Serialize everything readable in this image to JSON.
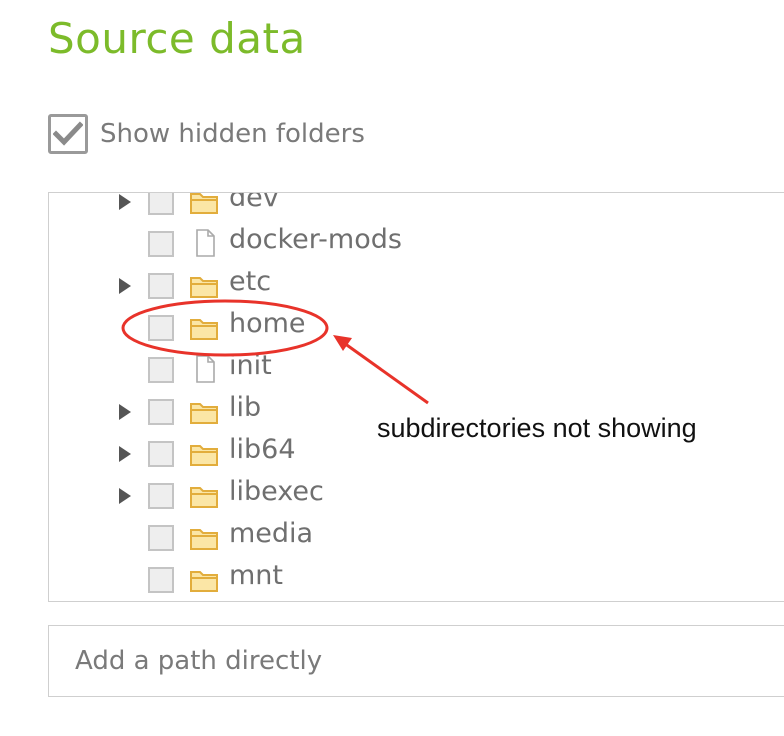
{
  "page": {
    "title": "Source data",
    "show_hidden": {
      "label": "Show hidden folders",
      "checked": true
    },
    "tree": {
      "items": [
        {
          "label": "dev",
          "icon": "folder-icon",
          "expandable": true
        },
        {
          "label": "docker-mods",
          "icon": "file-icon",
          "expandable": false
        },
        {
          "label": "etc",
          "icon": "folder-icon",
          "expandable": true
        },
        {
          "label": "home",
          "icon": "folder-icon",
          "expandable": false
        },
        {
          "label": "init",
          "icon": "file-icon",
          "expandable": false
        },
        {
          "label": "lib",
          "icon": "folder-icon",
          "expandable": true
        },
        {
          "label": "lib64",
          "icon": "folder-icon",
          "expandable": true
        },
        {
          "label": "libexec",
          "icon": "folder-icon",
          "expandable": true
        },
        {
          "label": "media",
          "icon": "folder-icon",
          "expandable": false
        },
        {
          "label": "mnt",
          "icon": "folder-icon",
          "expandable": false
        }
      ]
    },
    "path_input": {
      "placeholder": "Add a path directly",
      "value": ""
    }
  },
  "annotation": {
    "text": "subdirectories not showing",
    "color": "#e8332a"
  },
  "colors": {
    "title": "#7cbb2a",
    "folder": "#f2c25c",
    "annotation": "#e8332a"
  }
}
